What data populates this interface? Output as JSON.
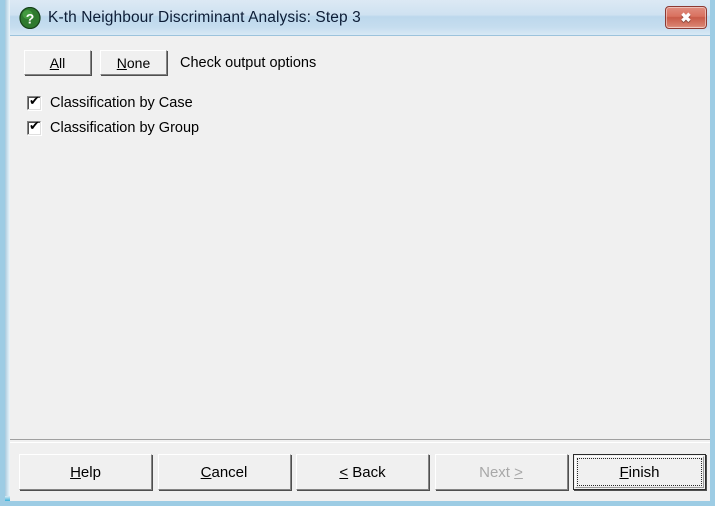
{
  "window": {
    "title": "K-th Neighbour Discriminant Analysis: Step 3",
    "icon": "question-mark-icon",
    "close_label": "✖",
    "accent_title_color": "#bcd8ec",
    "frame_color": "#9dcce4",
    "face_color": "#f0f0f0"
  },
  "toolbar": {
    "all_label_underlined": "A",
    "all_label_rest": "ll",
    "none_label_underlined": "N",
    "none_label_rest": "one",
    "instruction": "Check output options"
  },
  "options": [
    {
      "label": "Classification by Case",
      "checked": true,
      "tick": "✔"
    },
    {
      "label": "Classification by Group",
      "checked": true,
      "tick": "✔"
    }
  ],
  "footer": {
    "help": {
      "accel": "H",
      "rest": "elp",
      "enabled": true
    },
    "cancel": {
      "accel": "C",
      "rest": "ancel",
      "enabled": true
    },
    "back": {
      "accel": "<",
      "rest": " Back",
      "enabled": true
    },
    "next": {
      "pre": "Next ",
      "accel": ">",
      "enabled": false
    },
    "finish": {
      "accel": "F",
      "rest": "inish",
      "enabled": true,
      "is_default": true
    }
  }
}
